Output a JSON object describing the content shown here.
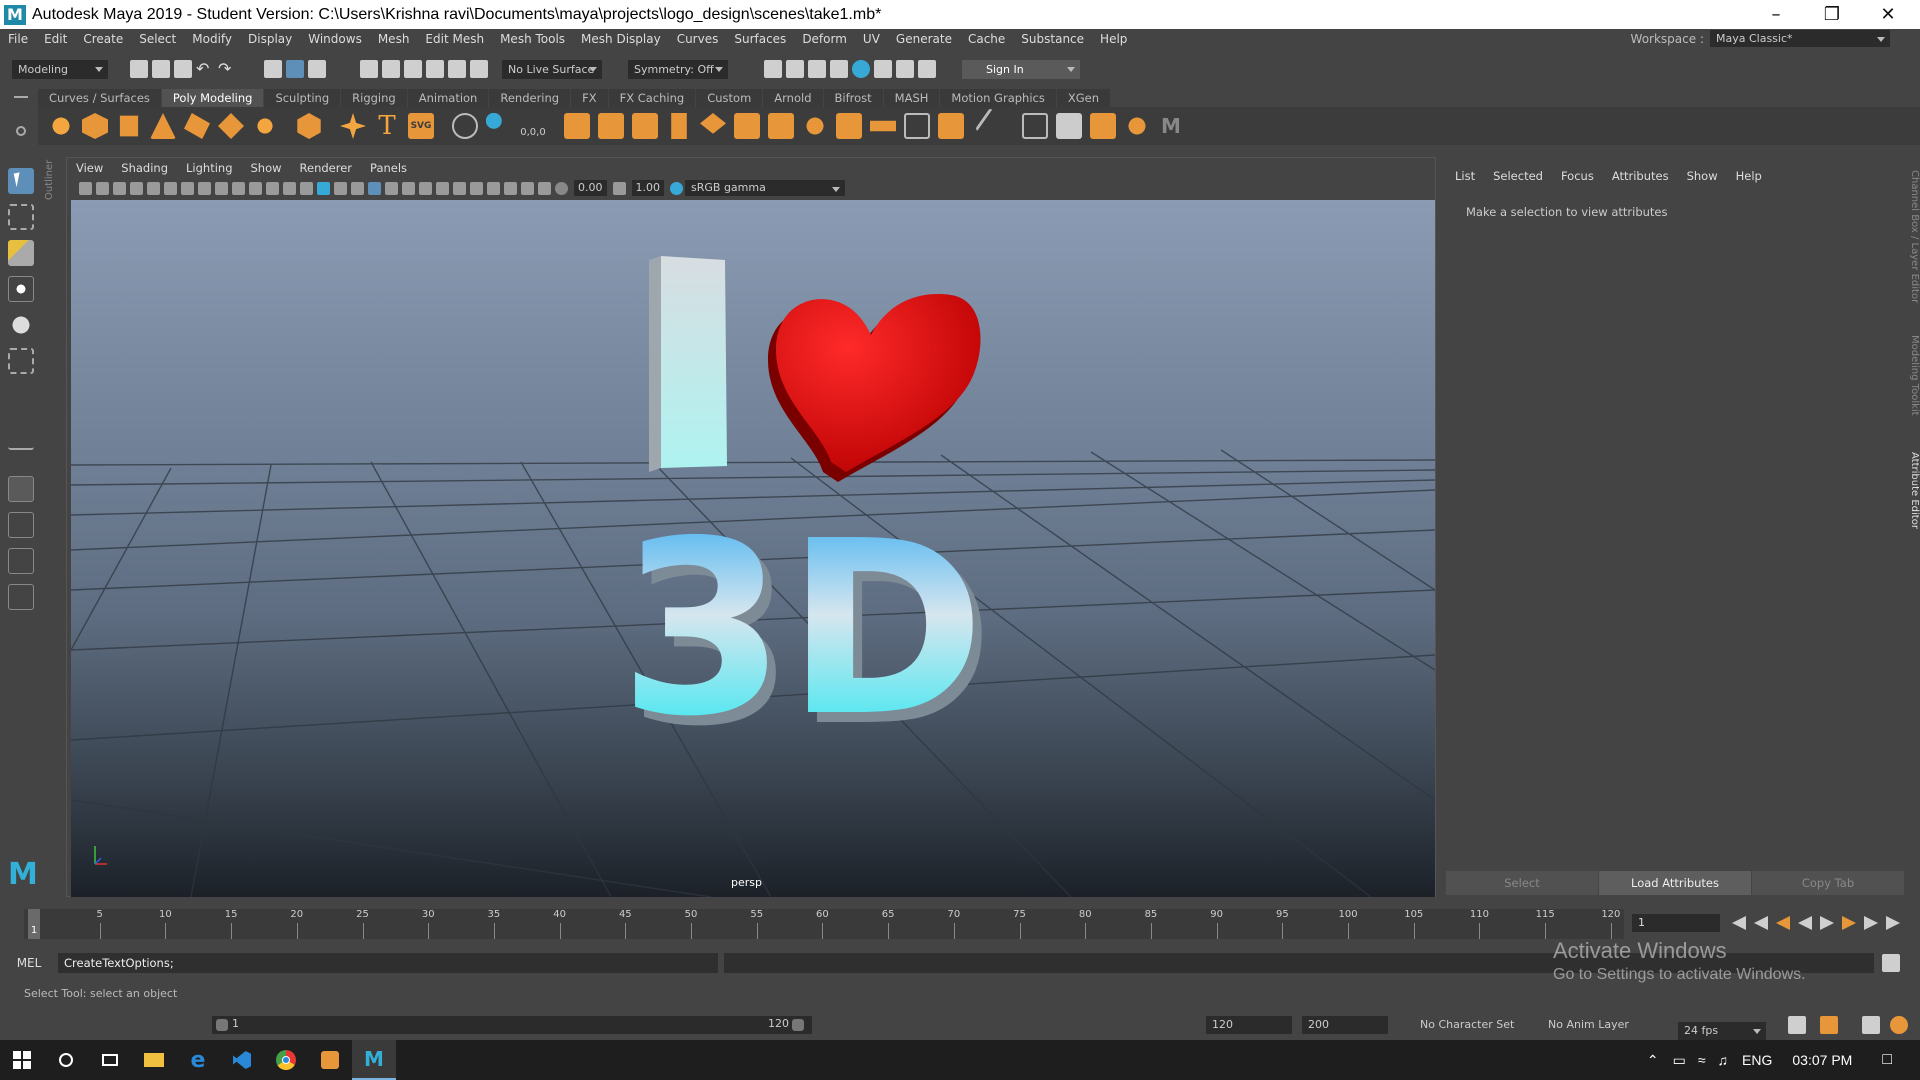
{
  "window": {
    "title": "Autodesk Maya 2019 - Student Version: C:\\Users\\Krishna ravi\\Documents\\maya\\projects\\logo_design\\scenes\\take1.mb*",
    "logo_letter": "M"
  },
  "menubar": {
    "items": [
      "File",
      "Edit",
      "Create",
      "Select",
      "Modify",
      "Display",
      "Windows",
      "Mesh",
      "Edit Mesh",
      "Mesh Tools",
      "Mesh Display",
      "Curves",
      "Surfaces",
      "Deform",
      "UV",
      "Generate",
      "Cache",
      "Substance",
      "Help"
    ],
    "workspace_label": "Workspace :",
    "workspace_value": "Maya Classic*"
  },
  "statusline": {
    "mode": "Modeling",
    "live_surface": "No Live Surface",
    "symmetry": "Symmetry: Off",
    "sign_in": "Sign In"
  },
  "shelf": {
    "tabs": [
      "Curves / Surfaces",
      "Poly Modeling",
      "Sculpting",
      "Rigging",
      "Animation",
      "Rendering",
      "FX",
      "FX Caching",
      "Custom",
      "Arnold",
      "Bifrost",
      "MASH",
      "Motion Graphics",
      "XGen"
    ],
    "active_tab": "Poly Modeling",
    "svg_label": "SVG",
    "text_label": "T",
    "coord_label": "0,0,0"
  },
  "panel": {
    "menu": [
      "View",
      "Shading",
      "Lighting",
      "Show",
      "Renderer",
      "Panels"
    ],
    "exposure": "0.00",
    "gamma": "1.00",
    "colorspace": "sRGB gamma",
    "camera_label": "persp",
    "outliner_tab": "Outliner"
  },
  "scene": {
    "letter_i": "I",
    "text_3d": "3D"
  },
  "attribute_editor": {
    "menu": [
      "List",
      "Selected",
      "Focus",
      "Attributes",
      "Show",
      "Help"
    ],
    "message": "Make a selection to view attributes",
    "buttons": [
      "Select",
      "Load Attributes",
      "Copy Tab"
    ]
  },
  "side_tabs": [
    "Channel Box / Layer Editor",
    "Modeling Toolkit",
    "Attribute Editor"
  ],
  "timeline": {
    "ticks": [
      "5",
      "10",
      "15",
      "20",
      "25",
      "30",
      "35",
      "40",
      "45",
      "50",
      "55",
      "60",
      "65",
      "70",
      "75",
      "80",
      "85",
      "90",
      "95",
      "100",
      "105",
      "110",
      "115",
      "120"
    ],
    "current_marker": "1",
    "current_frame": "1"
  },
  "command_line": {
    "label": "MEL",
    "value": "CreateTextOptions;"
  },
  "help_line": "Select Tool: select an object",
  "activation": {
    "line1": "Activate Windows",
    "line2": "Go to Settings to activate Windows."
  },
  "range": {
    "start": "1",
    "slider_end": "120",
    "end": "120",
    "max": "200",
    "character_set": "No Character Set",
    "anim_layer": "No Anim Layer",
    "fps": "24 fps"
  },
  "taskbar": {
    "language": "ENG",
    "time": "03:07 PM"
  },
  "colors": {
    "heart": "#e01010",
    "accent_blue": "#2a88d8",
    "text_3d_top": "#2aa8f0",
    "text_3d_bottom": "#18e8f0"
  }
}
